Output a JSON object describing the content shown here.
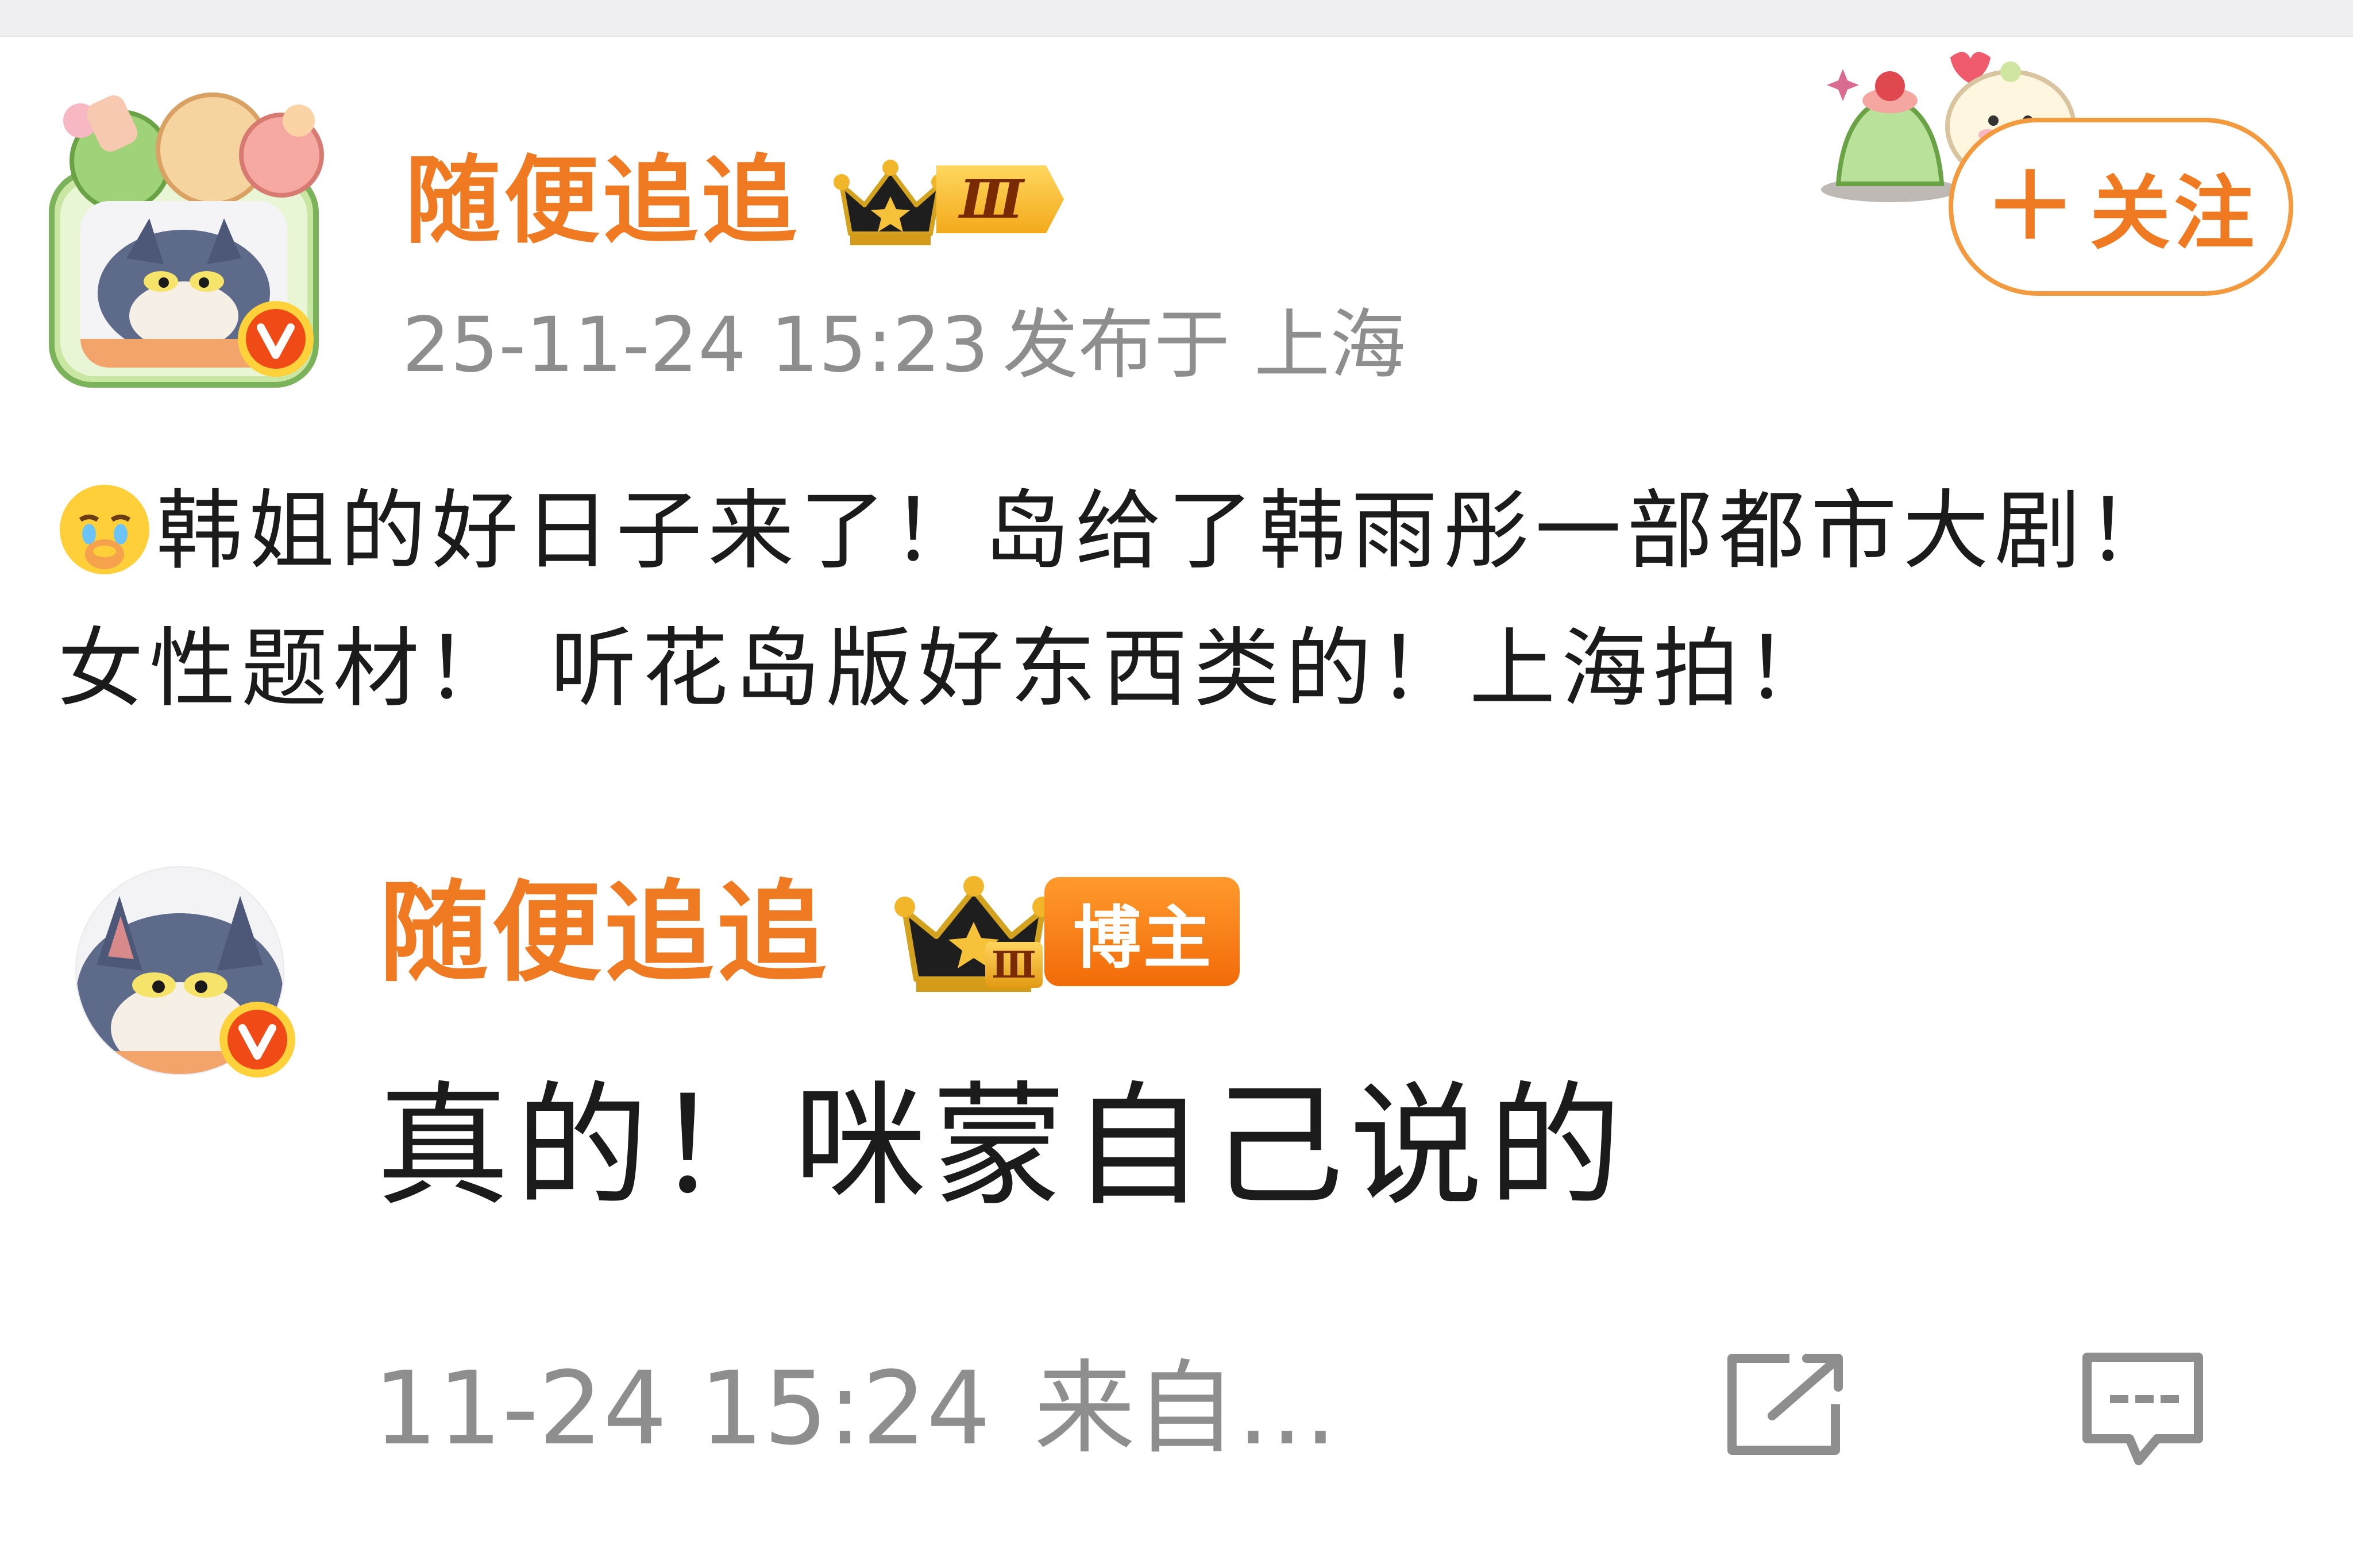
{
  "post": {
    "username": "随便追追",
    "level_badge": "Ⅲ",
    "timestamp": "25-11-24 15:23",
    "location": "发布于 上海",
    "follow_label": "关注",
    "follow_icon": "plus-icon",
    "text_line1": "韩姐的好日子来了！岛给了韩雨彤一部都市大剧！",
    "text_line2": "女性题材！ 听花岛版好东西类的！上海拍！",
    "leading_emoji": "crying-face-emoji"
  },
  "reply": {
    "username": "随便追追",
    "level_badge": "Ⅲ",
    "role_badge": "博主",
    "text": "真的！咪蒙自己说的",
    "timestamp": "11-24 15:24",
    "source": "来自…",
    "actions": [
      "share-icon",
      "comment-icon"
    ]
  },
  "colors": {
    "brand_orange": "#f07a22",
    "meta_gray": "#8e8e8e",
    "follow_border": "#f49a3e"
  }
}
